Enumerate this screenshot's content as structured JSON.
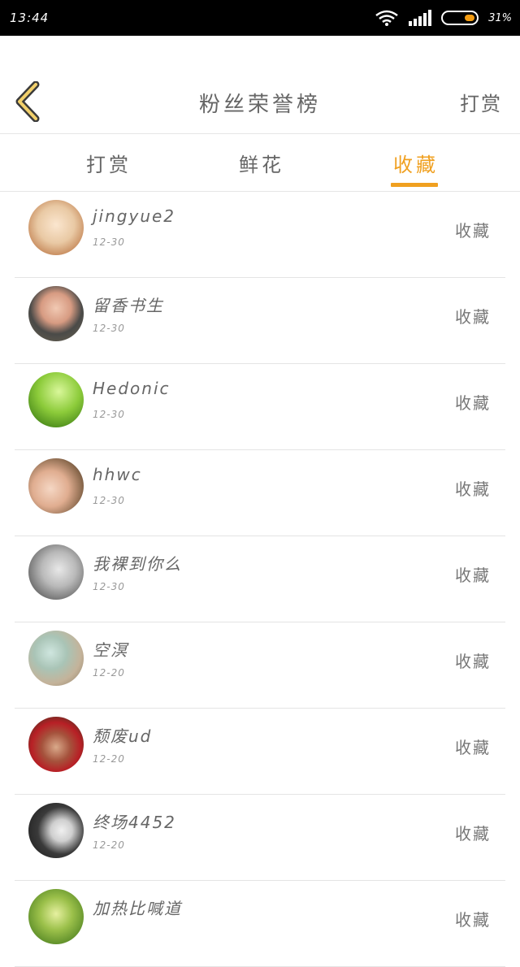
{
  "statusbar": {
    "time": "13:44",
    "battery_pct": "31%",
    "battery_color": "#f39c12"
  },
  "header": {
    "title": "粉丝荣誉榜",
    "right_action": "打赏",
    "back_icon": "chevron-left-icon"
  },
  "tabs": [
    {
      "label": "打赏",
      "active": false
    },
    {
      "label": "鲜花",
      "active": false
    },
    {
      "label": "收藏",
      "active": true
    }
  ],
  "accent_color": "#f0a020",
  "list": [
    {
      "name": "jingyue2",
      "date": "12-30",
      "action": "收藏"
    },
    {
      "name": "留香书生",
      "date": "12-30",
      "action": "收藏"
    },
    {
      "name": "Hedonic",
      "date": "12-30",
      "action": "收藏"
    },
    {
      "name": "hhwc",
      "date": "12-30",
      "action": "收藏"
    },
    {
      "name": "我裸到你么",
      "date": "12-30",
      "action": "收藏"
    },
    {
      "name": "空溟",
      "date": "12-20",
      "action": "收藏"
    },
    {
      "name": "颓废ud",
      "date": "12-20",
      "action": "收藏"
    },
    {
      "name": "终场4452",
      "date": "12-20",
      "action": "收藏"
    },
    {
      "name": "加热比喊道",
      "date": "",
      "action": "收藏"
    }
  ]
}
